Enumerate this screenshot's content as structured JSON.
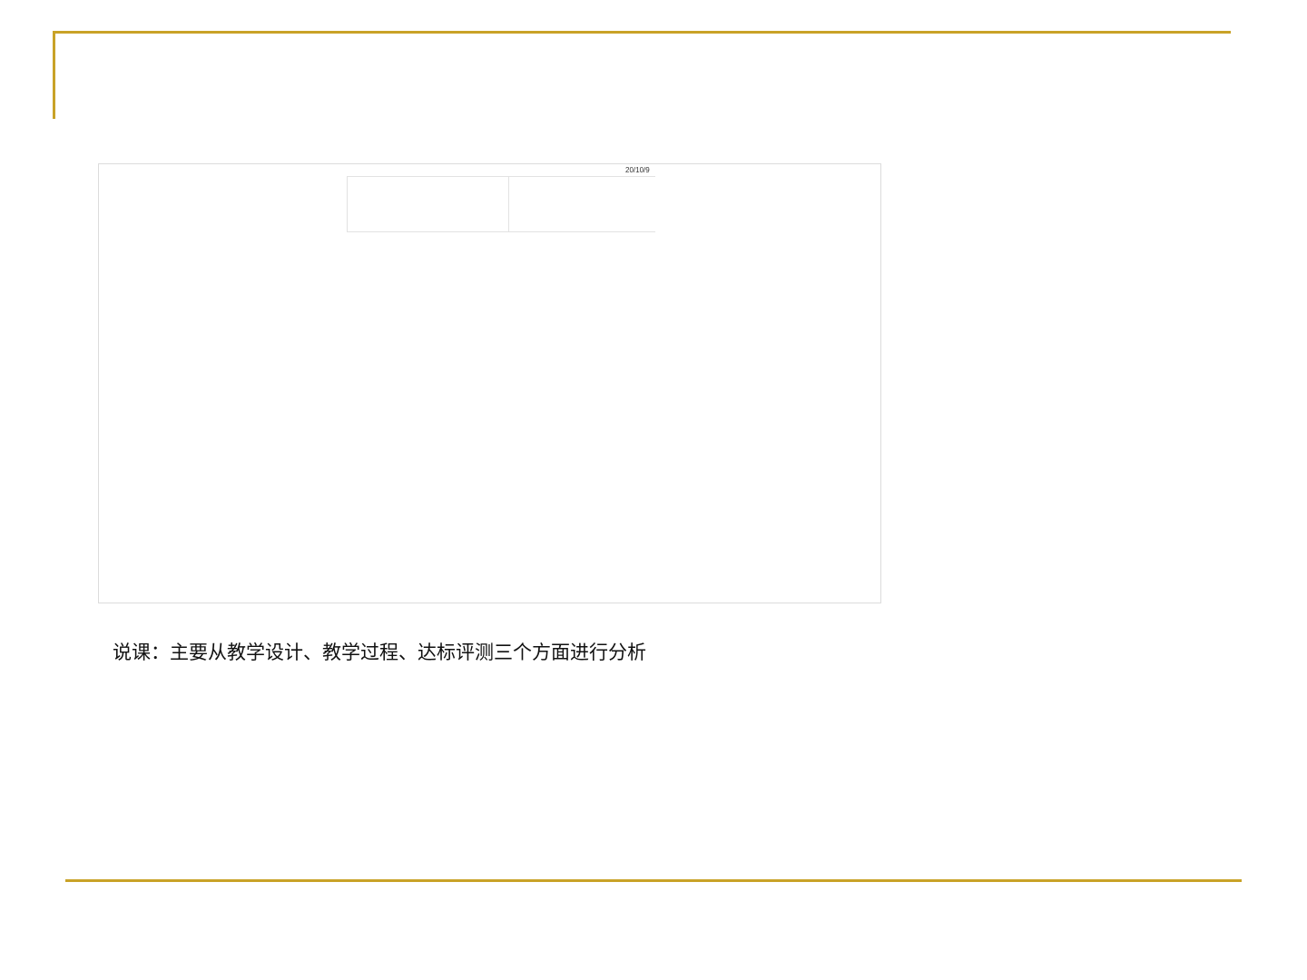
{
  "slide": {
    "frame_date": "20/10/9",
    "caption": "说课：主要从教学设计、教学过程、达标评测三个方面进行分析"
  },
  "colors": {
    "accent": "#c9a227",
    "frame_border": "#dcdcdc",
    "text": "#111111"
  }
}
